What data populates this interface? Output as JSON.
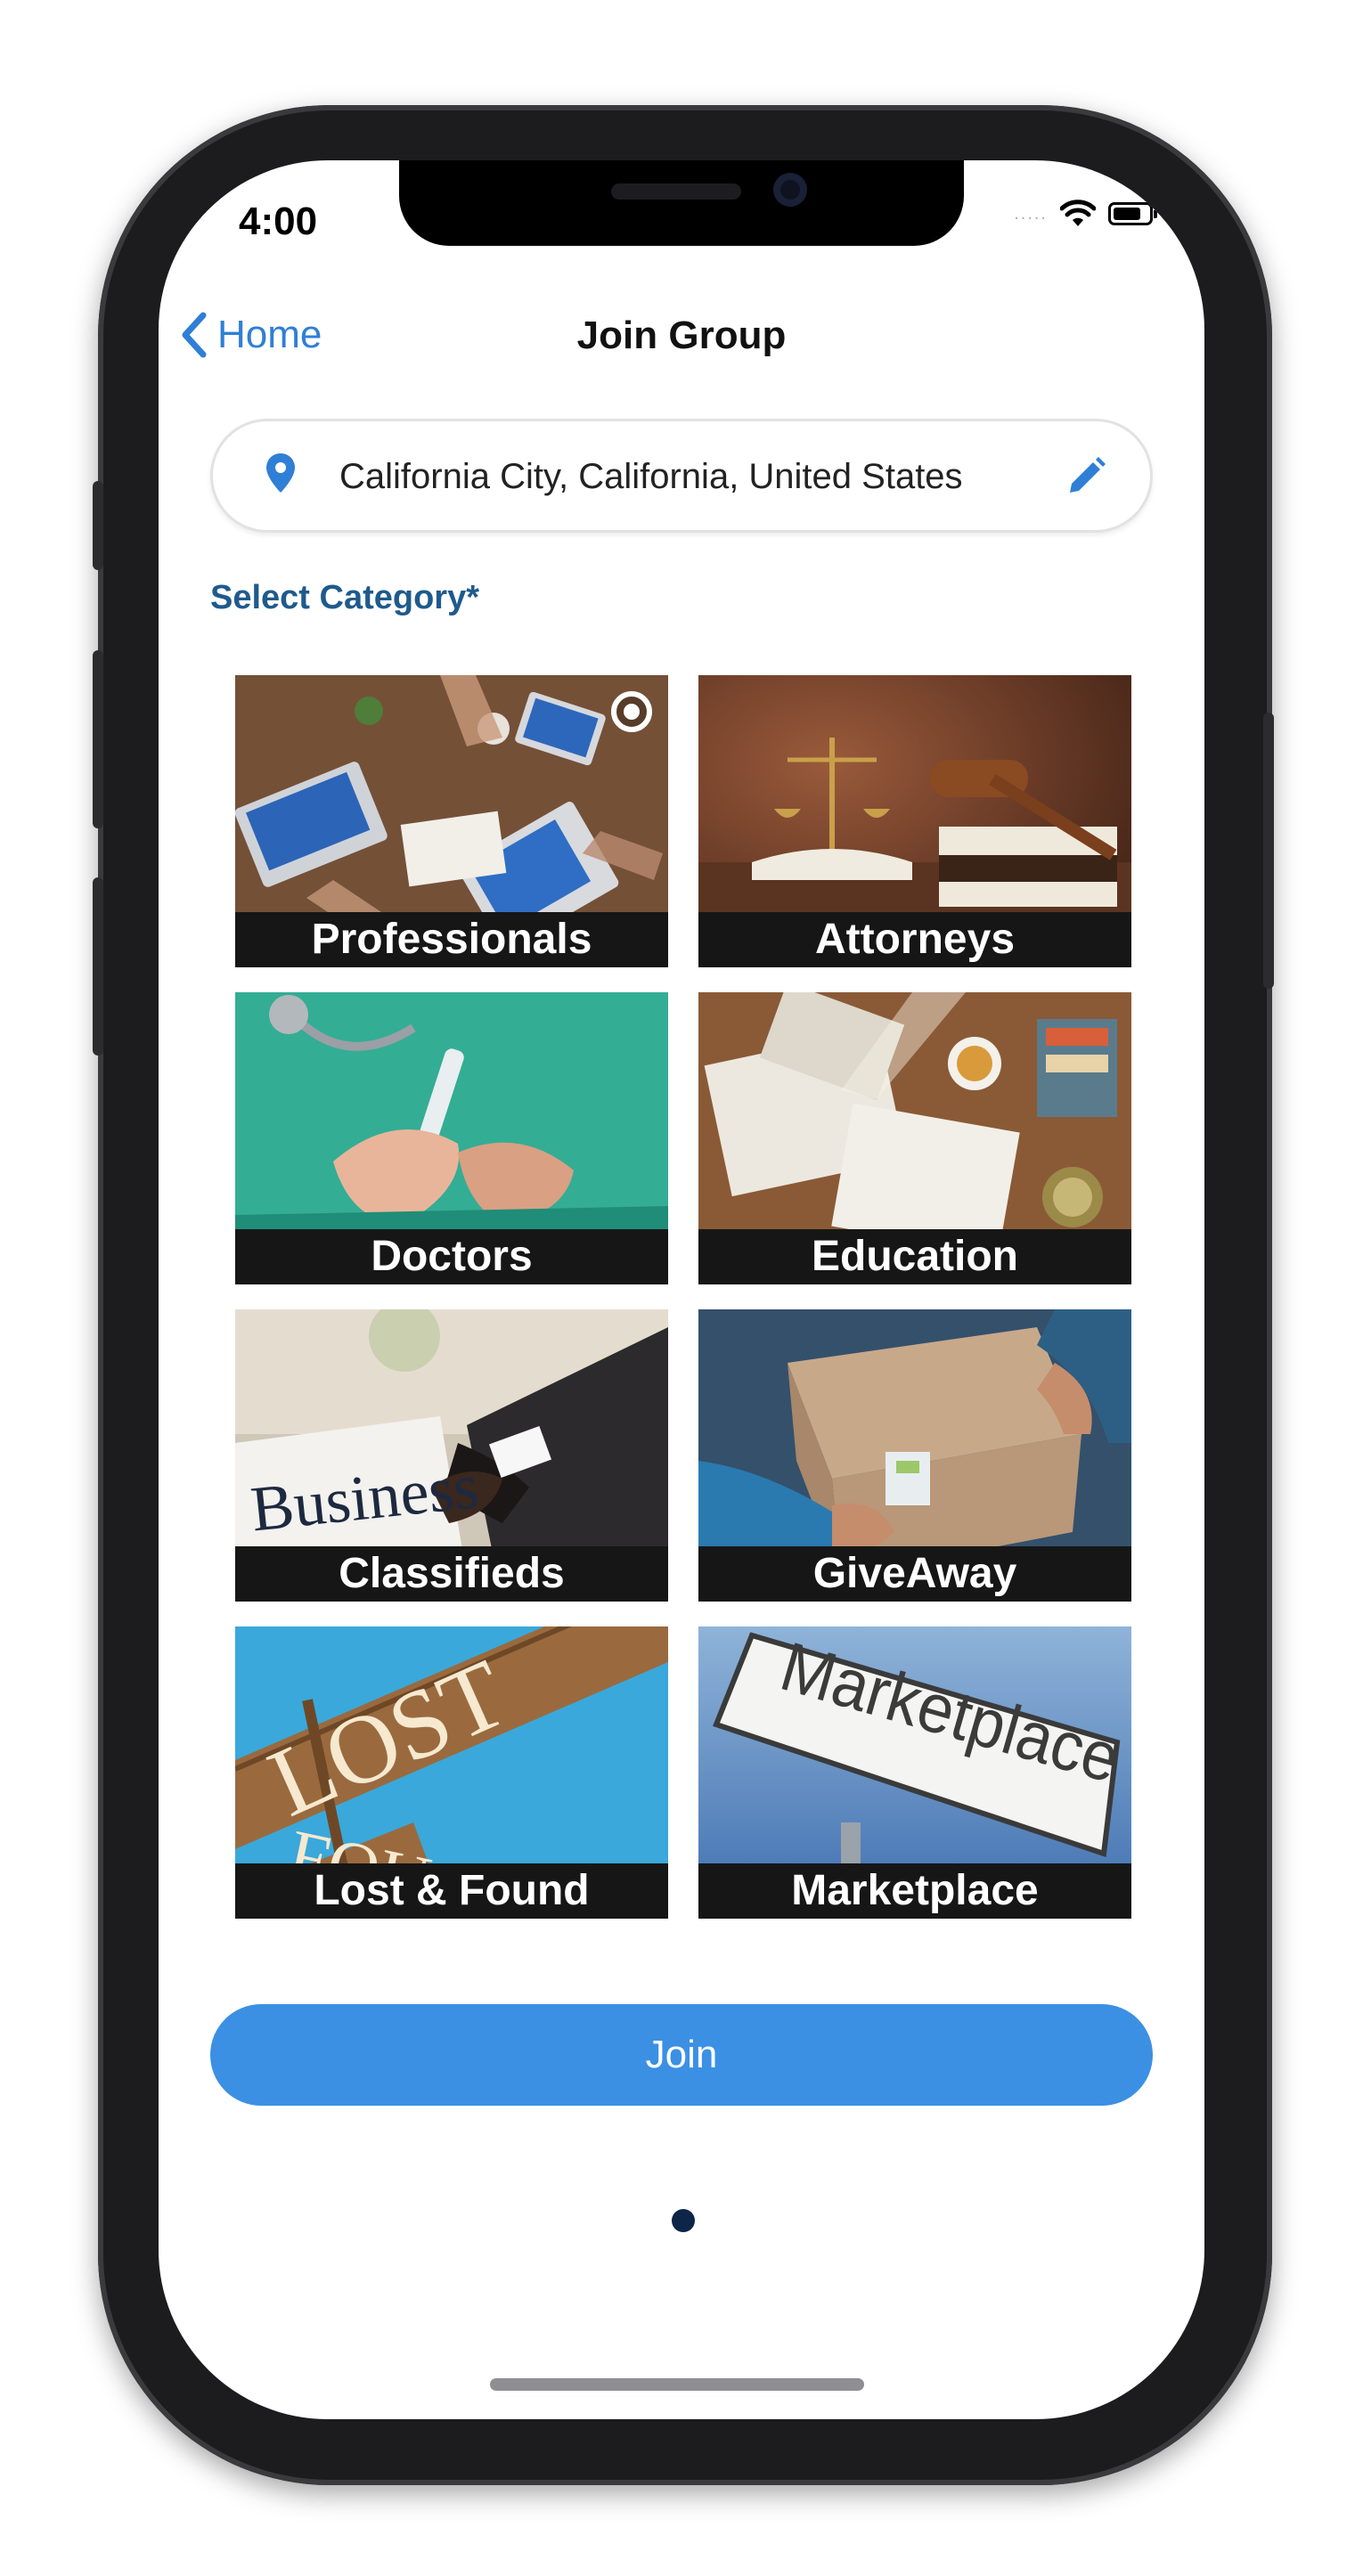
{
  "status_bar": {
    "time": "4:00",
    "signal": "....."
  },
  "nav": {
    "back_label": "Home",
    "title": "Join Group"
  },
  "location": {
    "value": "California City, California, United States"
  },
  "section": {
    "label": "Select Category*"
  },
  "categories": [
    {
      "label": "Professionals",
      "selected": true
    },
    {
      "label": "Attorneys",
      "selected": false
    },
    {
      "label": "Doctors",
      "selected": false
    },
    {
      "label": "Education",
      "selected": false
    },
    {
      "label": "Classifieds",
      "selected": false
    },
    {
      "label": "GiveAway",
      "selected": false
    },
    {
      "label": "Lost & Found",
      "selected": false
    },
    {
      "label": "Marketplace",
      "selected": false
    }
  ],
  "tile_text": {
    "business": "Business",
    "lost": "LOST",
    "found": "FOU",
    "marketplace_sign": "Marketplace"
  },
  "actions": {
    "join_label": "Join"
  },
  "pager": {
    "pages": 1,
    "current": 1
  },
  "colors": {
    "accent": "#2f7fd6",
    "button": "#3b90e4",
    "section_label": "#1f5a8c",
    "caption_bg": "#161616"
  }
}
